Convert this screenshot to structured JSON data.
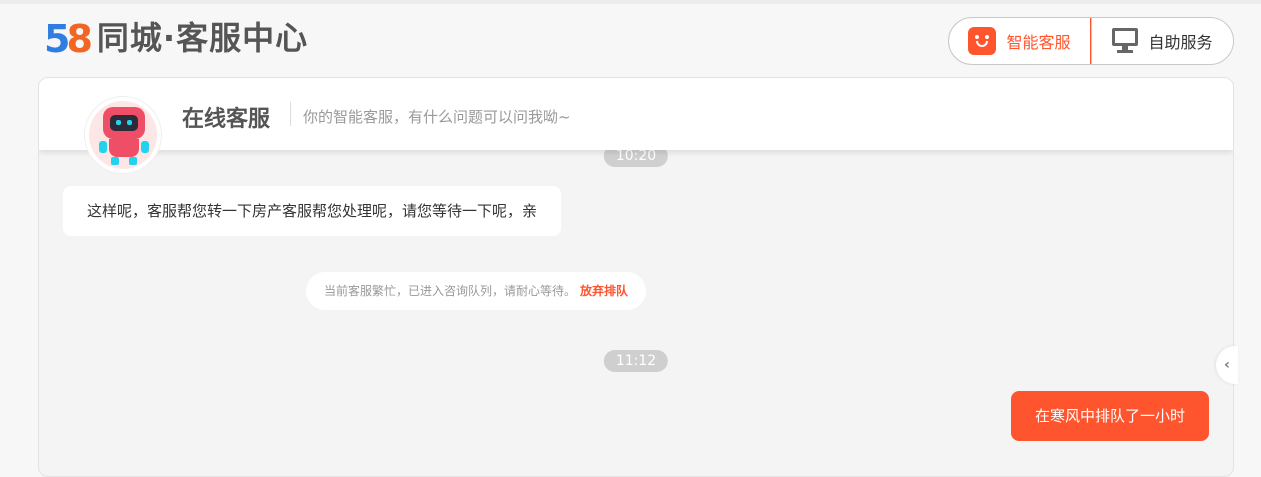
{
  "brand": {
    "logo_5": "5",
    "logo_8": "8",
    "logo_text": "同城·客服中心"
  },
  "service_switch": {
    "smart": "智能客服",
    "self": "自助服务"
  },
  "chat_header": {
    "title": "在线客服",
    "subtitle": "你的智能客服，有什么问题可以问我呦~"
  },
  "messages": {
    "time_1": "10:20",
    "agent_msg": "这样呢，客服帮您转一下房产客服帮您处理呢，请您等待一下呢，亲",
    "queue_notice": "当前客服繁忙，已进入咨询队列，请耐心等待。",
    "queue_action": "放弃排队",
    "time_2": "11:12",
    "user_msg": "在寒风中排队了一小时"
  },
  "side_toggle_icon": "‹",
  "colors": {
    "accent": "#ff552e",
    "logo_blue": "#2f7de1",
    "logo_orange": "#f26522"
  }
}
